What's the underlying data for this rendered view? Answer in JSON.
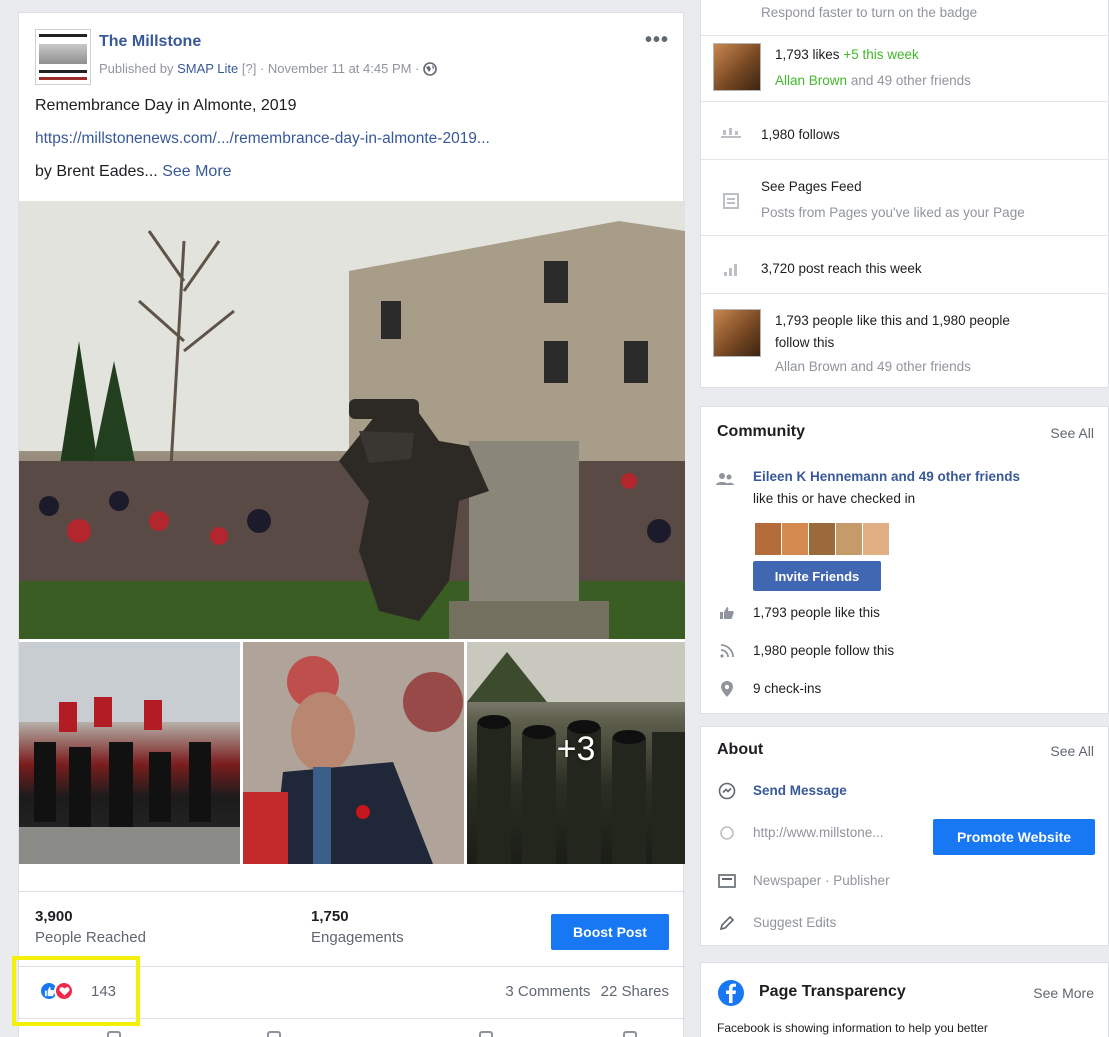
{
  "post": {
    "page_name": "The Millstone",
    "published_prefix": "Published by",
    "publisher_app": "SMAP Lite",
    "publisher_suffix": "[?] · November 11 at 4:45 PM ·",
    "more_label": "•••",
    "title_text": "Remembrance Day in Almonte, 2019",
    "link_text": "https://millstonenews.com/.../remembrance-day-in-almonte-2019...",
    "byline": "by Brent Eades...",
    "see_more": "See More",
    "extra_photos": "+3",
    "stats": [
      {
        "value": "3,900",
        "label": "People Reached"
      },
      {
        "value": "1,750",
        "label": "Engagements"
      }
    ],
    "boost_label": "Boost Post",
    "reaction_count": "143",
    "comments": "3 Comments",
    "shares": "22 Shares"
  },
  "sidebar": {
    "badge_text": "Respond faster to turn on the badge",
    "likes": "1,793 likes",
    "likes_delta": "+5 this week",
    "likes_friend_name": "Allan Brown",
    "likes_friends": "and 49 other friends",
    "follows": "1,980 follows",
    "pages_feed_title": "See Pages Feed",
    "pages_feed_sub": "Posts from Pages you've liked as your Page",
    "post_reach": "3,720 post reach this week",
    "like_follow_line1": "1,793 people like this and 1,980 people",
    "like_follow_line2": "follow this",
    "like_follow_friends": "Allan Brown and 49 other friends",
    "community": {
      "heading": "Community",
      "see_all": "See All",
      "friend_name": "Eileen K Hennemann and 49 other friends",
      "friend_sub": "like this or have checked in",
      "invite_label": "Invite Friends",
      "likes": "1,793 people like this",
      "follows": "1,980 people follow this",
      "checkins": "9 check-ins"
    },
    "about": {
      "heading": "About",
      "see_all": "See All",
      "send_message": "Send Message",
      "website": "http://www.millstone...",
      "promote_label": "Promote Website",
      "category": "Newspaper · Publisher",
      "suggest": "Suggest Edits"
    },
    "transparency": {
      "heading": "Page Transparency",
      "see_more": "See More",
      "body": "Facebook is showing information to help you better"
    }
  },
  "colors": {
    "brand_blue": "#1877f2",
    "link_blue": "#385898",
    "invite_blue": "#4267b2",
    "love_red": "#f0284a",
    "highlight_yellow": "#f5f00a",
    "green": "#42b72a"
  }
}
